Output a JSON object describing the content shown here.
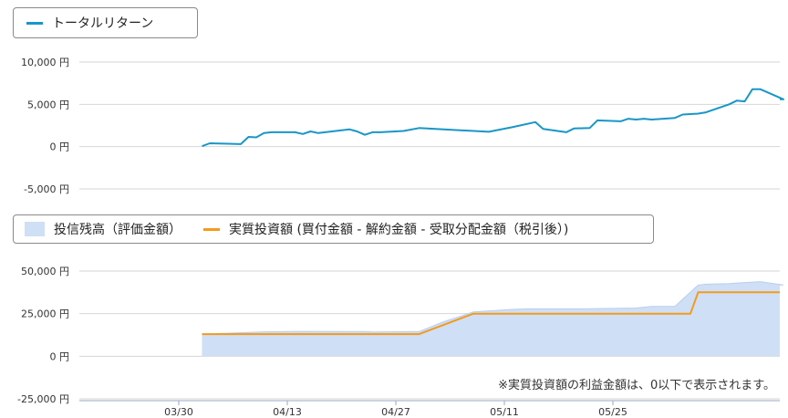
{
  "colors": {
    "total_return": "#1a96c6",
    "valuation_fill": "#cfdff5",
    "valuation_stroke": "#b9cfee",
    "net_investment": "#f39a1e",
    "grid": "#d6d6d6",
    "axis_text": "#333333"
  },
  "legend_top": {
    "series_name": "トータルリターン"
  },
  "legend_bottom": {
    "area_name": "投信残高（評価金額）",
    "line_name": "実質投資額 (買付金額 - 解約金額 - 受取分配金額（税引後）)"
  },
  "note": "※実質投資額の利益金額は、0以下で表示されます。",
  "chart_data": [
    {
      "type": "line",
      "y_ticks": [
        "10,000 円",
        "5,000 円",
        "0 円",
        "-5,000 円"
      ],
      "ylim": [
        -5000,
        10000
      ],
      "series": [
        {
          "name": "トータルリターン",
          "x": [
            "2025-04-02",
            "2025-04-03",
            "2025-04-07",
            "2025-04-08",
            "2025-04-09",
            "2025-04-10",
            "2025-04-11",
            "2025-04-14",
            "2025-04-15",
            "2025-04-16",
            "2025-04-17",
            "2025-04-21",
            "2025-04-22",
            "2025-04-23",
            "2025-04-24",
            "2025-04-25",
            "2025-04-28",
            "2025-04-30",
            "2025-05-09",
            "2025-05-12",
            "2025-05-15",
            "2025-05-16",
            "2025-05-19",
            "2025-05-20",
            "2025-05-22",
            "2025-05-23",
            "2025-05-26",
            "2025-05-27",
            "2025-05-28",
            "2025-05-29",
            "2025-05-30",
            "2025-06-02",
            "2025-06-03",
            "2025-06-05",
            "2025-06-06",
            "2025-06-09",
            "2025-06-10",
            "2025-06-11",
            "2025-06-12",
            "2025-06-13",
            "2025-06-16"
          ],
          "values": [
            50,
            400,
            300,
            1150,
            1100,
            1600,
            1700,
            1700,
            1500,
            1800,
            1600,
            2050,
            1800,
            1400,
            1700,
            1700,
            1850,
            2200,
            1750,
            2300,
            2900,
            2100,
            1700,
            2150,
            2200,
            3100,
            3000,
            3300,
            3200,
            3300,
            3200,
            3400,
            3800,
            3900,
            4050,
            5000,
            5450,
            5350,
            6800,
            6800,
            5600
          ]
        }
      ]
    },
    {
      "type": "area",
      "y_ticks": [
        "50,000 円",
        "25,000 円",
        "0 円",
        "-25,000 円"
      ],
      "ylim": [
        -25000,
        50000
      ],
      "x_ticks": [
        "03/30",
        "04/13",
        "04/27",
        "05/11",
        "05/25"
      ],
      "series": [
        {
          "name": "投信残高（評価金額）",
          "type": "area",
          "x": [
            "2025-04-02",
            "2025-04-08",
            "2025-04-10",
            "2025-04-14",
            "2025-04-23",
            "2025-04-24",
            "2025-04-30",
            "2025-05-03",
            "2025-05-07",
            "2025-05-12",
            "2025-05-14",
            "2025-05-21",
            "2025-05-28",
            "2025-05-30",
            "2025-06-02",
            "2025-06-05",
            "2025-06-06",
            "2025-06-09",
            "2025-06-10",
            "2025-06-13",
            "2025-06-16",
            "2025-06-19"
          ],
          "values": [
            13000,
            14000,
            14300,
            14600,
            14500,
            14200,
            14500,
            20000,
            26000,
            27500,
            27800,
            27800,
            28300,
            29200,
            29200,
            41800,
            42300,
            42600,
            43000,
            43800,
            41800,
            41800
          ]
        },
        {
          "name": "実質投資額 (買付金額 - 解約金額 - 受取分配金額（税引後）)",
          "type": "line",
          "x": [
            "2025-04-02",
            "2025-04-30",
            "2025-05-07",
            "2025-06-04",
            "2025-06-05",
            "2025-06-19"
          ],
          "values": [
            13000,
            13000,
            25000,
            25000,
            37500,
            37500
          ]
        }
      ]
    }
  ]
}
